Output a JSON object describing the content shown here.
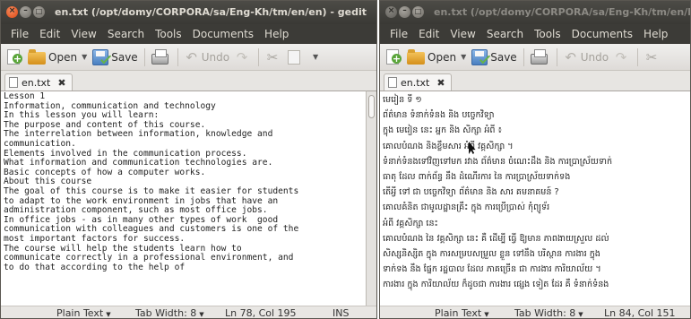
{
  "left_window": {
    "title": "en.txt (/opt/domy/CORPORA/sa/Eng-Kh/tm/en/en) - gedit",
    "menu": [
      "File",
      "Edit",
      "View",
      "Search",
      "Tools",
      "Documents",
      "Help"
    ],
    "toolbar": {
      "open_label": "Open",
      "save_label": "Save",
      "undo_label": "Undo"
    },
    "tab_label": "en.txt",
    "lines": [
      "Lesson 1",
      "Information, communication and technology",
      "In this lesson you will learn:",
      "The purpose and content of this course.",
      "The interrelation between information, knowledge and",
      "communication.",
      "Elements involved in the communication process.",
      "What information and communication technologies are.",
      "Basic concepts of how a computer works.",
      "About this course",
      "The goal of this course is to make it easier for students",
      "to adapt to the work environment in jobs that have an",
      "administration component, such as most office jobs.",
      "In office jobs - as in many other types of work  good",
      "communication with colleagues and customers is one of the",
      "most important factors for success.",
      "The course will help the students learn how to",
      "communicate correctly in a professional environment, and",
      "to do that according to the help of"
    ],
    "status": {
      "language": "Plain Text",
      "tab_width": "Tab Width: 8",
      "position": "Ln 78, Col 195",
      "mode": "INS"
    }
  },
  "right_window": {
    "title": "en.txt (/opt/domy/CORPORA/sa/Eng-Kh/tm/en/kh",
    "menu": [
      "File",
      "Edit",
      "View",
      "Search",
      "Tools",
      "Documents",
      "Help"
    ],
    "toolbar": {
      "open_label": "Open",
      "save_label": "Save",
      "undo_label": "Undo"
    },
    "tab_label": "en.txt",
    "lines": [
      "មេរៀន ទី ១",
      "ព័ត៌មាន ទំនាក់ទំនង និង បច្ចេកវិទ្យា",
      "ក្នុង មេរៀន នេះ អ្នក និង សិក្សា អំពី ៖",
      "គោលបំណង និងខ្លឹមសារ អំពី វគ្គសិក្សា ។",
      "ទំនាក់ទំនងទៅវិញទៅមក រវាង ព័ត៌មាន ចំណេះដឹង និង ការប្រាស្រ័យទាក់",
      "ធាតុ ដែល ពាក់ព័ន្ធ នឹង ដំណើរការ នៃ ការប្រាស្រ័យទាក់ទង",
      "តើអ្វី ទៅ ជា បច្ចេកវិទ្យា ព័ត៌មាន និង សារ គមនាគមន៍ ?",
      "គោលគំនិត ជាមូលដ្ឋានគ្រឹះ ក្នុង ការប្រើប្រាស់ កុំព្យូទ័រ",
      "អំពី វគ្គសិក្សា នេះ",
      "គោលបំណង នៃ វគ្គសិក្សា នេះ គឺ ដើម្បី ធ្វើ ឱ្យមាន ភាពងាយស្រួល ដល់",
      "សិស្សនិស្សិត ក្នុង ការសម្របសម្រួល ខ្លួន ទៅនឹង បរិស្ថាន ការងារ ក្នុង",
      "ទាក់ទង នឹង ផ្នែក រដ្ឋបាល ដែល ភាគច្រើន ជា ការងារ ការិយាល័យ ។",
      "ការងារ ក្នុង ការិយាល័យ ក៏ដូចជា ការងារ ផ្សេង ទៀត ដែរ គឺ ទំនាក់ទំនង"
    ],
    "status": {
      "language": "Plain Text",
      "tab_width": "Tab Width: 8",
      "position": "Ln 84, Col 151"
    }
  }
}
